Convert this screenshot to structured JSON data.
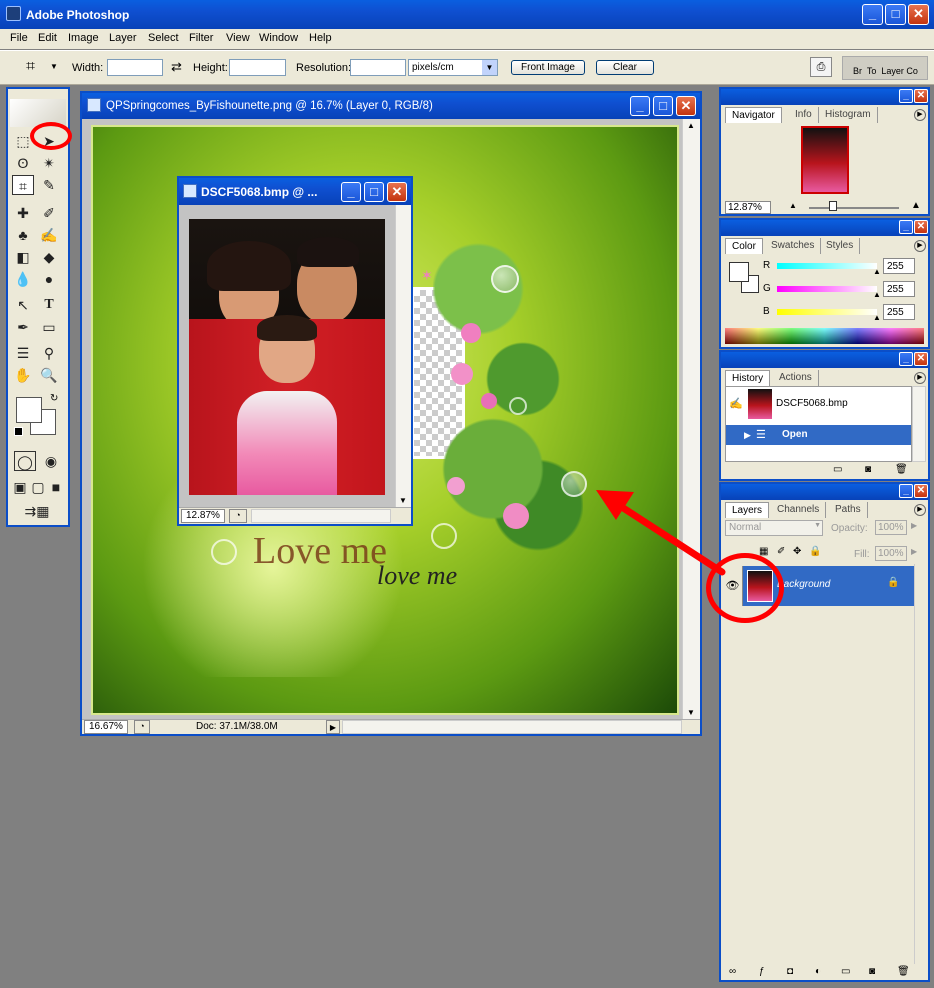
{
  "app": {
    "title": "Adobe Photoshop"
  },
  "menu": [
    "File",
    "Edit",
    "Image",
    "Layer",
    "Select",
    "Filter",
    "View",
    "Window",
    "Help"
  ],
  "options": {
    "width_label": "Width:",
    "height_label": "Height:",
    "resolution_label": "Resolution:",
    "units": "pixels/cm",
    "front_image": "Front Image",
    "clear": "Clear",
    "well_tabs": "Br  To  Layer Co"
  },
  "main_doc": {
    "title": "QPSpringcomes_ByFishounette.png @ 16.7% (Layer 0, RGB/8)",
    "zoom": "16.67%",
    "doc_info": "Doc: 37.1M/38.0M",
    "overlay_text": "Love me",
    "overlay_script": "love me"
  },
  "sub_doc": {
    "title": "DSCF5068.bmp @ ...",
    "zoom": "12.87%"
  },
  "navigator": {
    "tabs": [
      "Navigator",
      "Info",
      "Histogram"
    ],
    "zoom": "12.87%"
  },
  "color": {
    "tabs": [
      "Color",
      "Swatches",
      "Styles"
    ],
    "r_label": "R",
    "g_label": "G",
    "b_label": "B",
    "r": "255",
    "g": "255",
    "b": "255"
  },
  "history": {
    "tabs": [
      "History",
      "Actions"
    ],
    "snapshot": "DSCF5068.bmp",
    "step": "Open"
  },
  "layers": {
    "tabs": [
      "Layers",
      "Channels",
      "Paths"
    ],
    "blend": "Normal",
    "opacity_label": "Opacity:",
    "opacity": "100%",
    "fill_label": "Fill:",
    "fill": "100%",
    "layer_name": "Background"
  },
  "colors": {
    "xp_blue": "#0b4ec8",
    "highlight": "#316ac5",
    "annotation_red": "#ff0000"
  }
}
